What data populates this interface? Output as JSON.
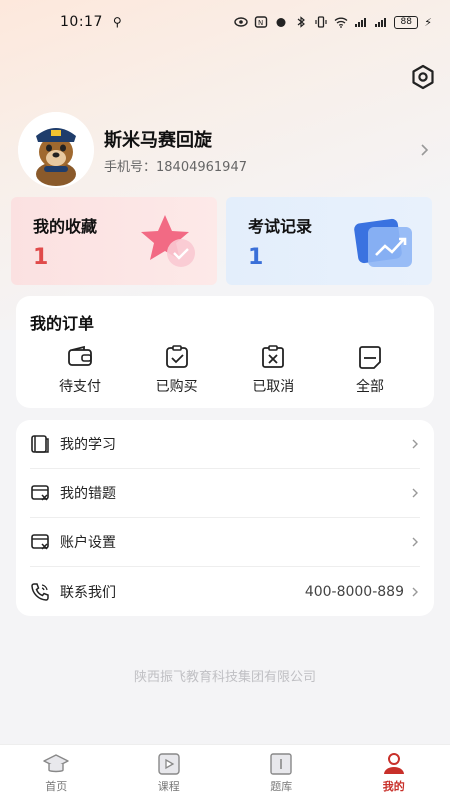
{
  "status_bar": {
    "time": "10:17",
    "usb_icon": "usb-icon",
    "battery": "88"
  },
  "profile": {
    "name": "斯米马赛回旋",
    "phone_label": "手机号：",
    "phone": "18404961947"
  },
  "cards": {
    "favorites": {
      "title": "我的收藏",
      "count": "1",
      "accent": "#e04a4a"
    },
    "exam_records": {
      "title": "考试记录",
      "count": "1",
      "accent": "#3a6fd8"
    }
  },
  "orders": {
    "title": "我的订单",
    "items": [
      {
        "label": "待支付",
        "icon": "wallet-icon"
      },
      {
        "label": "已购买",
        "icon": "clipboard-check-icon"
      },
      {
        "label": "已取消",
        "icon": "clipboard-x-icon"
      },
      {
        "label": "全部",
        "icon": "document-icon"
      }
    ]
  },
  "menu": {
    "items": [
      {
        "label": "我的学习",
        "icon": "book-icon",
        "value": ""
      },
      {
        "label": "我的错题",
        "icon": "wrong-questions-icon",
        "value": ""
      },
      {
        "label": "账户设置",
        "icon": "account-settings-icon",
        "value": ""
      },
      {
        "label": "联系我们",
        "icon": "phone-icon",
        "value": "400-8000-889"
      }
    ]
  },
  "footer": {
    "company": "陕西振飞教育科技集团有限公司"
  },
  "tabs": [
    {
      "label": "首页",
      "icon": "graduation-cap-icon",
      "active": false
    },
    {
      "label": "课程",
      "icon": "video-course-icon",
      "active": false
    },
    {
      "label": "题库",
      "icon": "question-bank-icon",
      "active": false
    },
    {
      "label": "我的",
      "icon": "user-icon",
      "active": true
    }
  ],
  "colors": {
    "brand_red": "#c8302a",
    "page_bg": "#f4f4f6"
  }
}
